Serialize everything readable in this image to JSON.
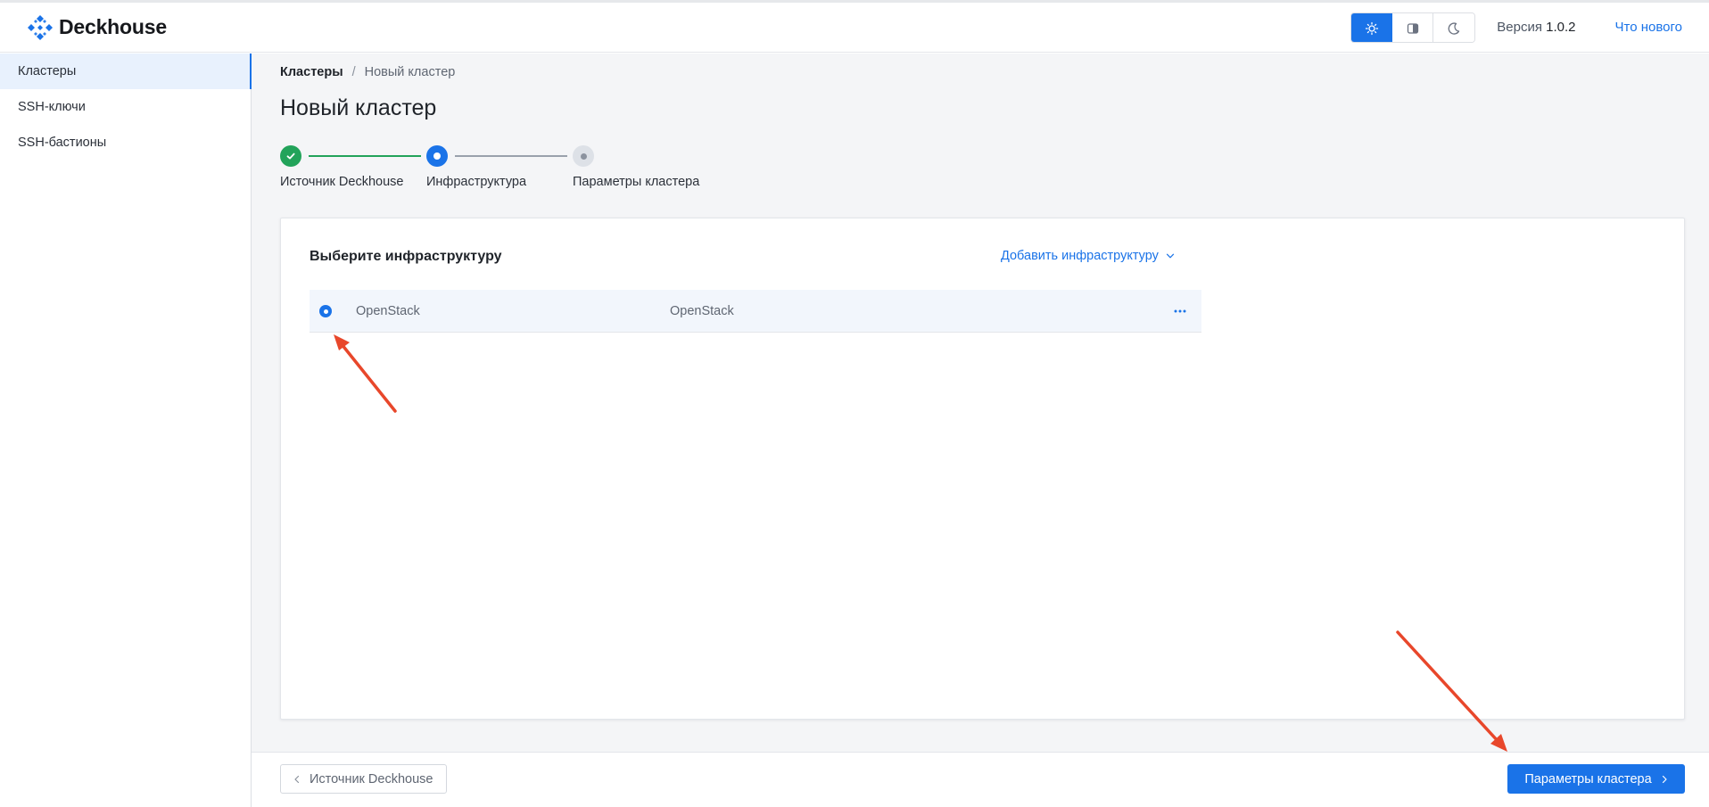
{
  "header": {
    "brand": "Deckhouse",
    "theme_buttons": [
      {
        "name": "sun-icon",
        "active": true
      },
      {
        "name": "system-icon",
        "active": false
      },
      {
        "name": "moon-icon",
        "active": false
      }
    ],
    "version_label": "Версия",
    "version_value": "1.0.2",
    "whats_new": "Что нового"
  },
  "sidebar": {
    "items": [
      {
        "label": "Кластеры",
        "active": true
      },
      {
        "label": "SSH-ключи",
        "active": false
      },
      {
        "label": "SSH-бастионы",
        "active": false
      }
    ]
  },
  "breadcrumb": {
    "root": "Кластеры",
    "separator": "/",
    "current": "Новый кластер"
  },
  "page": {
    "title": "Новый кластер"
  },
  "stepper": {
    "steps": [
      {
        "label": "Источник Deckhouse",
        "state": "done"
      },
      {
        "label": "Инфраструктура",
        "state": "current"
      },
      {
        "label": "Параметры кластера",
        "state": "pending"
      }
    ]
  },
  "card": {
    "title": "Выберите инфраструктуру",
    "add_button": "Добавить инфраструктуру",
    "rows": [
      {
        "name": "OpenStack",
        "provider": "OpenStack",
        "selected": true
      }
    ]
  },
  "footer": {
    "back_label": "Источник Deckhouse",
    "next_label": "Параметры кластера"
  },
  "colors": {
    "accent": "#1a73e8",
    "success": "#22a35a",
    "annotation_arrow": "#e8472b"
  }
}
